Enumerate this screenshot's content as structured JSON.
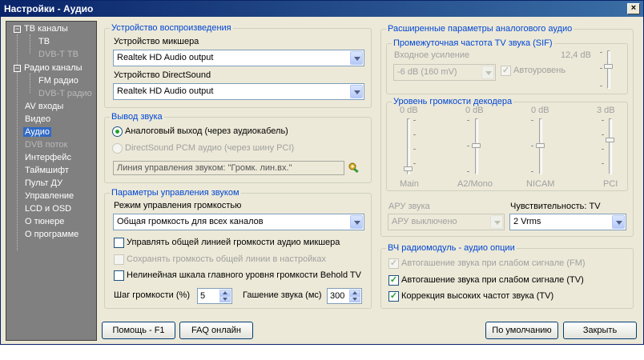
{
  "window": {
    "title": "Настройки - Аудио",
    "close_glyph": "×"
  },
  "sidebar": {
    "items": [
      {
        "label": "ТВ каналы",
        "disabled": false,
        "expander": "−"
      },
      {
        "label": "ТВ",
        "disabled": false
      },
      {
        "label": "DVB-T ТВ",
        "disabled": true
      },
      {
        "label": "Радио каналы",
        "disabled": false,
        "expander": "−"
      },
      {
        "label": "FM радио",
        "disabled": false
      },
      {
        "label": "DVB-T радио",
        "disabled": true
      },
      {
        "label": "AV входы",
        "disabled": false
      },
      {
        "label": "Видео",
        "disabled": false
      },
      {
        "label": "Аудио",
        "disabled": false,
        "selected": true
      },
      {
        "label": "DVB поток",
        "disabled": true
      },
      {
        "label": "Интерфейс",
        "disabled": false
      },
      {
        "label": "Таймшифт",
        "disabled": false
      },
      {
        "label": "Пульт ДУ",
        "disabled": false
      },
      {
        "label": "Управление",
        "disabled": false
      },
      {
        "label": "LCD и OSD",
        "disabled": false
      },
      {
        "label": "О тюнере",
        "disabled": false
      },
      {
        "label": "О программе",
        "disabled": false
      }
    ]
  },
  "playback": {
    "title": "Устройство воспроизведения",
    "mixer_label": "Устройство микшера",
    "mixer_value": "Realtek HD Audio output",
    "ds_label": "Устройство DirectSound",
    "ds_value": "Realtek HD Audio output"
  },
  "output": {
    "title": "Вывод звука",
    "analog_label": "Аналоговый выход (через аудиокабель)",
    "ds_pcm_label": "DirectSound PCM аудио (через шину PCI)",
    "line_field": "Линия управления звуком: \"Громк. лин.вх.\""
  },
  "volume": {
    "title": "Параметры управления звуком",
    "mode_label": "Режим управления громкостью",
    "mode_value": "Общая громкость для всех каналов",
    "cb1": "Управлять общей линией громкости аудио микшера",
    "cb2": "Сохранять громкость общей линии в настройках",
    "cb3": "Нелинейная шкала главного уровня громкости Behold TV",
    "step_label": "Шаг громкости (%)",
    "step_value": "5",
    "mute_label": "Гашение звука (мс)",
    "mute_value": "300"
  },
  "analog": {
    "title": "Расширенные параметры аналогового аудио",
    "sif_title": "Промежуточная частота TV звука (SIF)",
    "input_gain_label": "Входное усиление",
    "input_gain_db": "12,4 dB",
    "input_gain_value": "-6 dB (160 mV)",
    "autolevel_label": "Автоуровень",
    "decoder_title": "Уровень громкости декодера",
    "sliders": [
      {
        "db": "0 dB",
        "name": "Main"
      },
      {
        "db": "0 dB",
        "name": "A2/Mono"
      },
      {
        "db": "0 dB",
        "name": "NICAM"
      },
      {
        "db": "3 dB",
        "name": "PCI"
      }
    ],
    "agc_label": "АРУ звука",
    "agc_value": "АРУ выключено",
    "sens_label": "Чувствительность: TV",
    "sens_value": "2 Vrms"
  },
  "rf": {
    "title": "ВЧ радиомодуль - аудио опции",
    "cb1": "Автогашение звука при слабом сигнале (FM)",
    "cb2": "Автогашение звука при слабом сигнале (TV)",
    "cb3": "Коррекция высоких частот звука (TV)",
    "check_glyph": "✓"
  },
  "buttons": {
    "help": "Помощь - F1",
    "faq": "FAQ онлайн",
    "defaults": "По умолчанию",
    "close": "Закрыть"
  }
}
